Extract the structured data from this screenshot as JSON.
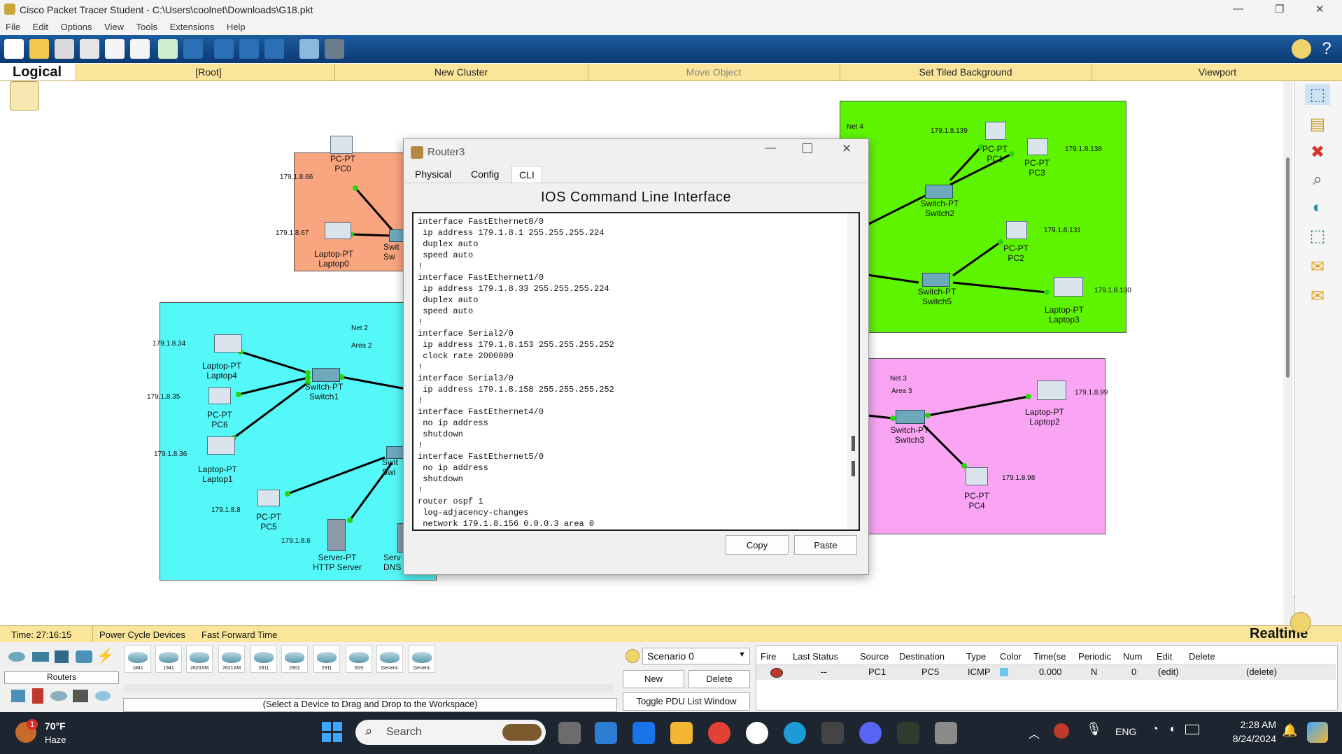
{
  "window": {
    "title": "Cisco Packet Tracer Student - C:\\Users\\coolnet\\Downloads\\G18.pkt"
  },
  "menu": [
    "File",
    "Edit",
    "Options",
    "View",
    "Tools",
    "Extensions",
    "Help"
  ],
  "navbar": {
    "mode": "Logical",
    "items": [
      "[Root]",
      "New Cluster",
      "Move Object",
      "Set Tiled Background",
      "Viewport"
    ]
  },
  "topology": {
    "zones": [
      {
        "name": "orange",
        "color": "#f9a57f"
      },
      {
        "name": "cyan",
        "color": "#55f8f8",
        "net": "Net 2",
        "area": "Area 2"
      },
      {
        "name": "green",
        "color": "#5ef400",
        "net": "Net 4"
      },
      {
        "name": "pink",
        "color": "#f9a5f3",
        "net": "Net 3",
        "area": "Area 3"
      }
    ],
    "devices": {
      "pc0": [
        "PC-PT",
        "PC0"
      ],
      "laptop0": [
        "Laptop-PT",
        "Laptop0"
      ],
      "sw_orange": [
        "Swit",
        "Sw"
      ],
      "laptop4": [
        "Laptop-PT",
        "Laptop4"
      ],
      "pc6": [
        "PC-PT",
        "PC6"
      ],
      "laptop1": [
        "Laptop-PT",
        "Laptop1"
      ],
      "switch1": [
        "Switch-PT",
        "Switch1"
      ],
      "pc5": [
        "PC-PT",
        "PC5"
      ],
      "server_http": [
        "Server-PT",
        "HTTP Server"
      ],
      "server_dns": [
        "Serv",
        "DNS"
      ],
      "sw_cyan": [
        "Swit",
        "Swi"
      ],
      "pc1": [
        "PC-PT",
        "PC1"
      ],
      "pc3": [
        "PC-PT",
        "PC3"
      ],
      "switch2": [
        "Switch-PT",
        "Switch2"
      ],
      "pc2": [
        "PC-PT",
        "PC2"
      ],
      "switch5": [
        "Switch-PT",
        "Switch5"
      ],
      "laptop3": [
        "Laptop-PT",
        "Laptop3"
      ],
      "switch3": [
        "Switch-PT",
        "Switch3"
      ],
      "laptop2": [
        "Laptop-PT",
        "Laptop2"
      ],
      "pc4": [
        "PC-PT",
        "PC4"
      ]
    },
    "ips": {
      "pc0": "179.1.8.66",
      "laptop0": "179.1.8.67",
      "laptop4": "179.1.8.34",
      "pc6": "179.1.8.35",
      "laptop1": "179.1.8.36",
      "pc5": "179.1.8.8",
      "server": "179.1.8.6",
      "pc1": "179.1.8.139",
      "pc3": "179.1.8.138",
      "pc2": "179.1.8.131",
      "laptop3": "179.1.8.130",
      "laptop2": "179.1.8.99",
      "pc4": "179.1.8.98"
    }
  },
  "router_dialog": {
    "title": "Router3",
    "tabs": [
      "Physical",
      "Config",
      "CLI"
    ],
    "active_tab": "CLI",
    "heading": "IOS Command Line Interface",
    "cli_text": "interface FastEthernet0/0\n ip address 179.1.8.1 255.255.255.224\n duplex auto\n speed auto\n!\ninterface FastEthernet1/0\n ip address 179.1.8.33 255.255.255.224\n duplex auto\n speed auto\n!\ninterface Serial2/0\n ip address 179.1.8.153 255.255.255.252\n clock rate 2000000\n!\ninterface Serial3/0\n ip address 179.1.8.158 255.255.255.252\n!\ninterface FastEthernet4/0\n no ip address\n shutdown\n!\ninterface FastEthernet5/0\n no ip address\n shutdown\n!\nrouter ospf 1\n log-adjacency-changes\n network 179.1.8.156 0.0.0.3 area 0",
    "copy_label": "Copy",
    "paste_label": "Paste"
  },
  "status": {
    "time": "Time: 27:16:15",
    "power_cycle": "Power Cycle Devices",
    "fast_forward": "Fast Forward Time",
    "mode": "Realtime"
  },
  "device_panel": {
    "category": "Routers",
    "models": [
      "1841",
      "1941",
      "2620XM",
      "2621XM",
      "2811",
      "2901",
      "2911",
      "819",
      "Generic",
      "Generic"
    ],
    "hint": "(Select a Device to Drag and Drop to the Workspace)"
  },
  "scenario": {
    "selected": "Scenario 0",
    "new_label": "New",
    "delete_label": "Delete",
    "toggle_label": "Toggle PDU List Window"
  },
  "pdu_table": {
    "headers": [
      "Fire",
      "Last Status",
      "Source",
      "Destination",
      "Type",
      "Color",
      "Time(se",
      "Periodic",
      "Num",
      "Edit",
      "Delete"
    ],
    "rows": [
      {
        "last_status": "--",
        "source": "PC1",
        "destination": "PC5",
        "type": "ICMP",
        "color": "#6cc6f0",
        "time": "0.000",
        "periodic": "N",
        "num": "0",
        "edit": "(edit)",
        "delete": "(delete)"
      }
    ]
  },
  "taskbar": {
    "weather_temp": "70°F",
    "weather_desc": "Haze",
    "badge": "1",
    "search_placeholder": "Search",
    "lang": "ENG",
    "time": "2:28 AM",
    "date": "8/24/2024"
  }
}
